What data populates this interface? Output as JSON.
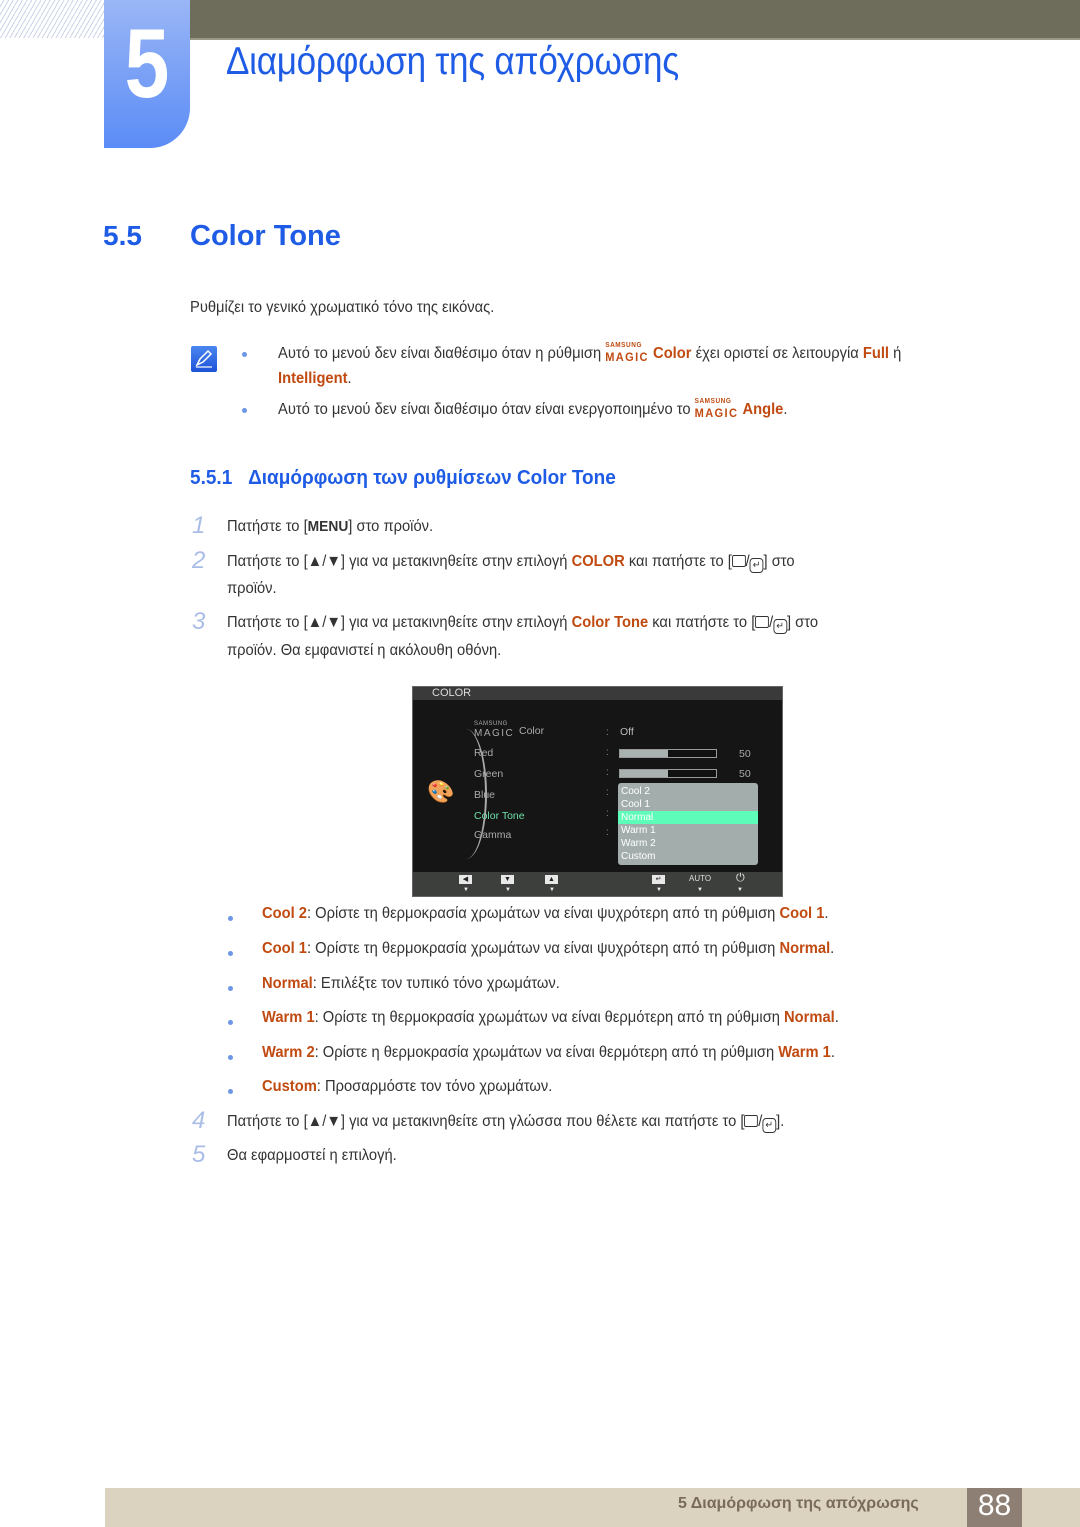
{
  "chapter": {
    "number": "5",
    "title": "Διαμόρφωση της απόχρωσης"
  },
  "section": {
    "number": "5.5",
    "title": "Color Tone"
  },
  "intro": "Ρυθμίζει το γενικό χρωματικό τόνο της εικόνας.",
  "notes": {
    "icon": "note-pencil-icon",
    "magic_top": "SAMSUNG",
    "magic_bottom": "MAGIC",
    "n1_pre": "Αυτό το μενού δεν είναι διαθέσιμο όταν η ρύθμιση ",
    "n1_feature": "Color",
    "n1_mid": " έχει οριστεί σε λειτουργία ",
    "n1_full": "Full",
    "n1_or": " ή",
    "n1_intelligent": "Intelligent",
    "n1_end": ".",
    "n2_pre": "Αυτό το μενού δεν είναι διαθέσιμο όταν είναι ενεργοποιημένο το ",
    "n2_feature": "Angle",
    "n2_end": "."
  },
  "subsection": {
    "number": "5.5.1",
    "title": "Διαμόρφωση των ρυθμίσεων Color Tone"
  },
  "steps": [
    {
      "num": "1",
      "pre": "Πατήστε το [",
      "key": "MENU",
      "post": "] στο προϊόν."
    },
    {
      "num": "2",
      "pre": "Πατήστε το [▲/▼] για να μετακινηθείτε στην επιλογή ",
      "target": "COLOR",
      "post": " και πατήστε το [",
      "post2": "] στο",
      "line2": "προϊόν."
    },
    {
      "num": "3",
      "pre": "Πατήστε το [▲/▼] για να μετακινηθείτε στην επιλογή ",
      "target": "Color Tone",
      "post": " και πατήστε το [",
      "post2": "] στο",
      "line2": "προϊόν. Θα εμφανιστεί η ακόλουθη οθόνη."
    },
    {
      "num": "4",
      "pre": "Πατήστε το [▲/▼] για να μετακινηθείτε στη γλώσσα που θέλετε και πατήστε το [",
      "post": "]."
    },
    {
      "num": "5",
      "pre": "Θα εφαρμοστεί η επιλογή."
    }
  ],
  "osd": {
    "title": "COLOR",
    "magic_top": "SAMSUNG",
    "magic_bottom": "MAGIC",
    "items": [
      {
        "label": "Color",
        "value": "Off"
      },
      {
        "label": "Red",
        "level": 0.5,
        "value": "50"
      },
      {
        "label": "Green",
        "level": 0.5,
        "value": "50"
      },
      {
        "label": "Blue"
      },
      {
        "label": "Color Tone",
        "active": true
      },
      {
        "label": "Gamma"
      }
    ],
    "options": [
      "Cool 2",
      "Cool 1",
      "Normal",
      "Warm 1",
      "Warm 2",
      "Custom"
    ],
    "selected": "Normal",
    "buttons": [
      "left-arrow",
      "down-arrow",
      "up-arrow",
      "enter",
      "AUTO",
      "power"
    ],
    "auto_label": "AUTO"
  },
  "options_desc": [
    {
      "name": "Cool 2",
      "text": ": Ορίστε τη θερμοκρασία χρωμάτων να είναι ψυχρότερη από τη ρύθμιση ",
      "ref": "Cool 1",
      "end": "."
    },
    {
      "name": "Cool 1",
      "text": ": Ορίστε τη θερμοκρασία χρωμάτων να είναι ψυχρότερη από τη ρύθμιση ",
      "ref": "Normal",
      "end": "."
    },
    {
      "name": "Normal",
      "text": ": Επιλέξτε τον τυπικό τόνο χρωμάτων.",
      "ref": "",
      "end": ""
    },
    {
      "name": "Warm 1",
      "text": ": Ορίστε τη θερμοκρασία χρωμάτων να είναι θερμότερη από τη ρύθμιση ",
      "ref": "Normal",
      "end": "."
    },
    {
      "name": "Warm 2",
      "text": ": Ορίστε η θερμοκρασία χρωμάτων να είναι θερμότερη από τη ρύθμιση ",
      "ref": "Warm 1",
      "end": "."
    },
    {
      "name": "Custom",
      "text": ": Προσαρμόστε τον τόνο χρωμάτων.",
      "ref": "",
      "end": ""
    }
  ],
  "footer": {
    "text": "5 Διαμόρφωση της απόχρωσης",
    "page": "88"
  },
  "colors": {
    "heading_blue": "#1f5ce6",
    "highlight_orange": "#c04a10",
    "osd_selected": "#5dfdb9",
    "footer_bg": "#dbd3c0",
    "page_box": "#8d7f73"
  }
}
